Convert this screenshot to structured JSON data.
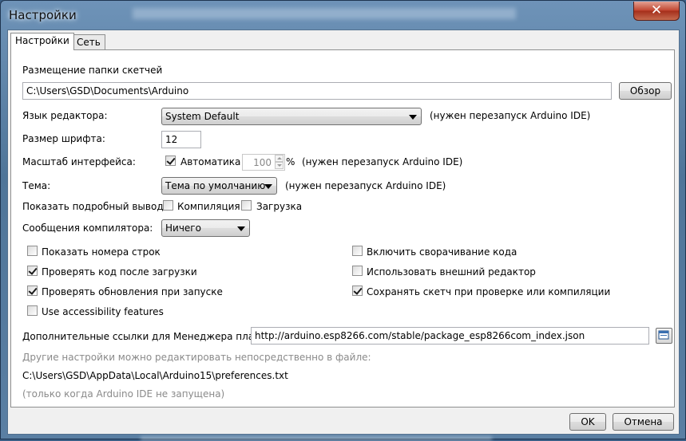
{
  "window": {
    "title": "Настройки"
  },
  "tabs": [
    {
      "label": "Настройки"
    },
    {
      "label": "Сеть"
    }
  ],
  "sketchbook": {
    "label": "Размещение папки скетчей",
    "path": "C:\\Users\\GSD\\Documents\\Arduino",
    "browse_label": "Обзор"
  },
  "language": {
    "label": "Язык редактора:",
    "value": "System Default",
    "note": "(нужен перезапуск Arduino IDE)"
  },
  "font_size": {
    "label": "Размер шрифта:",
    "value": "12"
  },
  "scale": {
    "label": "Масштаб интерфейса:",
    "auto_label": "Автоматика",
    "auto_checked": true,
    "value": "100",
    "percent": "%",
    "note": "(нужен перезапуск Arduino IDE)"
  },
  "theme": {
    "label": "Тема:",
    "value": "Тема по умолчанию",
    "note": "(нужен перезапуск Arduino IDE)"
  },
  "verbose": {
    "label": "Показать подробный вывод:",
    "compile_label": "Компиляция",
    "compile_checked": false,
    "upload_label": "Загрузка",
    "upload_checked": false
  },
  "warnings": {
    "label": "Сообщения компилятора:",
    "value": "Ничего"
  },
  "options_left": [
    {
      "label": "Показать номера строк",
      "checked": false
    },
    {
      "label": "Проверять код после загрузки",
      "checked": true
    },
    {
      "label": "Проверять обновления при запуске",
      "checked": true
    },
    {
      "label": "Use accessibility features",
      "checked": false
    }
  ],
  "options_right": [
    {
      "label": "Включить сворачивание кода",
      "checked": false
    },
    {
      "label": "Использовать внешний редактор",
      "checked": false
    },
    {
      "label": "Сохранять скетч при проверке или компиляции",
      "checked": true
    }
  ],
  "boards": {
    "label": "Дополнительные ссылки для Менеджера плат:",
    "url": "http://arduino.esp8266.com/stable/package_esp8266com_index.json"
  },
  "more_prefs": {
    "label": "Другие настройки можно редактировать непосредственно в файле:",
    "path": "C:\\Users\\GSD\\AppData\\Local\\Arduino15\\preferences.txt",
    "note": "(только когда Arduino IDE не запущена)"
  },
  "footer": {
    "ok_label": "OK",
    "cancel_label": "Отмена"
  },
  "colors": {
    "title_bar": "#5a7fa3",
    "close_button": "#c0432d",
    "panel_bg": "#ffffff",
    "frame_bg": "#f0f0f0"
  }
}
